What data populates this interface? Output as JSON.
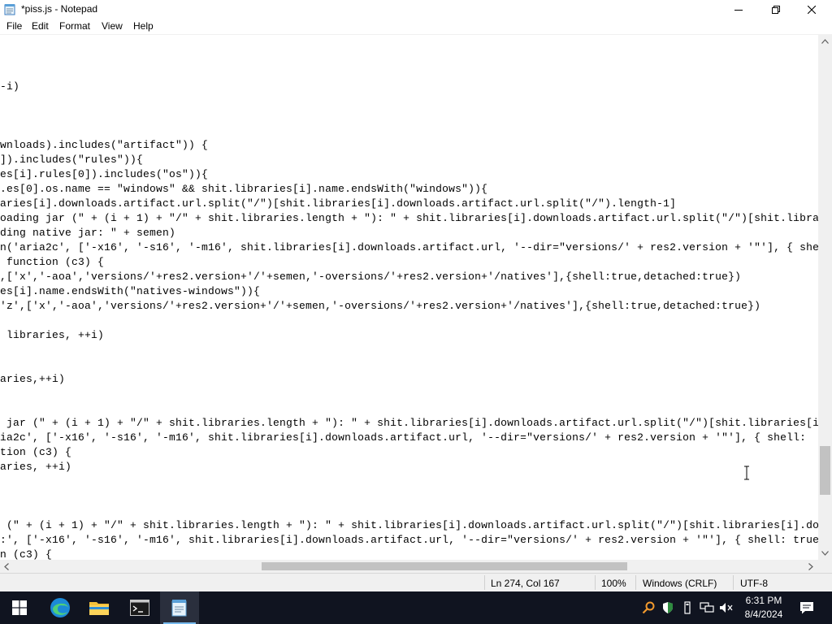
{
  "window": {
    "title": "*piss.js - Notepad",
    "icon": "notepad-icon"
  },
  "menu": {
    "items": [
      "File",
      "Edit",
      "Format",
      "View",
      "Help"
    ]
  },
  "editor": {
    "lines": [
      "-i)",
      "",
      "",
      "",
      "wnloads).includes(\"artifact\")) {",
      "]).includes(\"rules\")){",
      "es[i].rules[0]).includes(\"os\")){",
      ".es[0].os.name == \"windows\" && shit.libraries[i].name.endsWith(\"windows\")){",
      "aries[i].downloads.artifact.url.split(\"/\")[shit.libraries[i].downloads.artifact.url.split(\"/\").length-1]",
      "oading jar (\" + (i + 1) + \"/\" + shit.libraries.length + \"): \" + shit.libraries[i].downloads.artifact.url.split(\"/\")[shit.libra",
      "ding native jar: \" + semen)",
      "n('aria2c', ['-x16', '-s16', '-m16', shit.libraries[i].downloads.artifact.url, '--dir=\"versions/' + res2.version + '\"'], { she",
      " function (c3) {",
      ",['x','-aoa','versions/'+res2.version+'/'+semen,'-oversions/'+res2.version+'/natives'],{shell:true,detached:true})",
      "es[i].name.endsWith(\"natives-windows\")){",
      "'z',['x','-aoa','versions/'+res2.version+'/'+semen,'-oversions/'+res2.version+'/natives'],{shell:true,detached:true})",
      "",
      " libraries, ++i)",
      "",
      "",
      "aries,++i)",
      "",
      "",
      " jar (\" + (i + 1) + \"/\" + shit.libraries.length + \"): \" + shit.libraries[i].downloads.artifact.url.split(\"/\")[shit.libraries[i",
      "ia2c', ['-x16', '-s16', '-m16', shit.libraries[i].downloads.artifact.url, '--dir=\"versions/' + res2.version + '\"'], { shell:",
      "tion (c3) {",
      "aries, ++i)",
      "",
      "",
      "",
      " (\" + (i + 1) + \"/\" + shit.libraries.length + \"): \" + shit.libraries[i].downloads.artifact.url.split(\"/\")[shit.libraries[i].do",
      ":', ['-x16', '-s16', '-m16', shit.libraries[i].downloads.artifact.url, '--dir=\"versions/' + res2.version + '\"'], { shell: true",
      "n (c3) {"
    ]
  },
  "status": {
    "position": "Ln 274, Col 167",
    "zoom": "100%",
    "line_ending": "Windows (CRLF)",
    "encoding": "UTF-8"
  },
  "taskbar": {
    "apps": [
      "start-icon",
      "edge-icon",
      "file-explorer-icon",
      "terminal-icon",
      "notepad-icon"
    ],
    "time": "6:31 PM",
    "date": "8/4/2024"
  },
  "colors": {
    "taskbar": "#101420",
    "accent": "#76b9ed",
    "status_bar": "#f0f0f0"
  }
}
